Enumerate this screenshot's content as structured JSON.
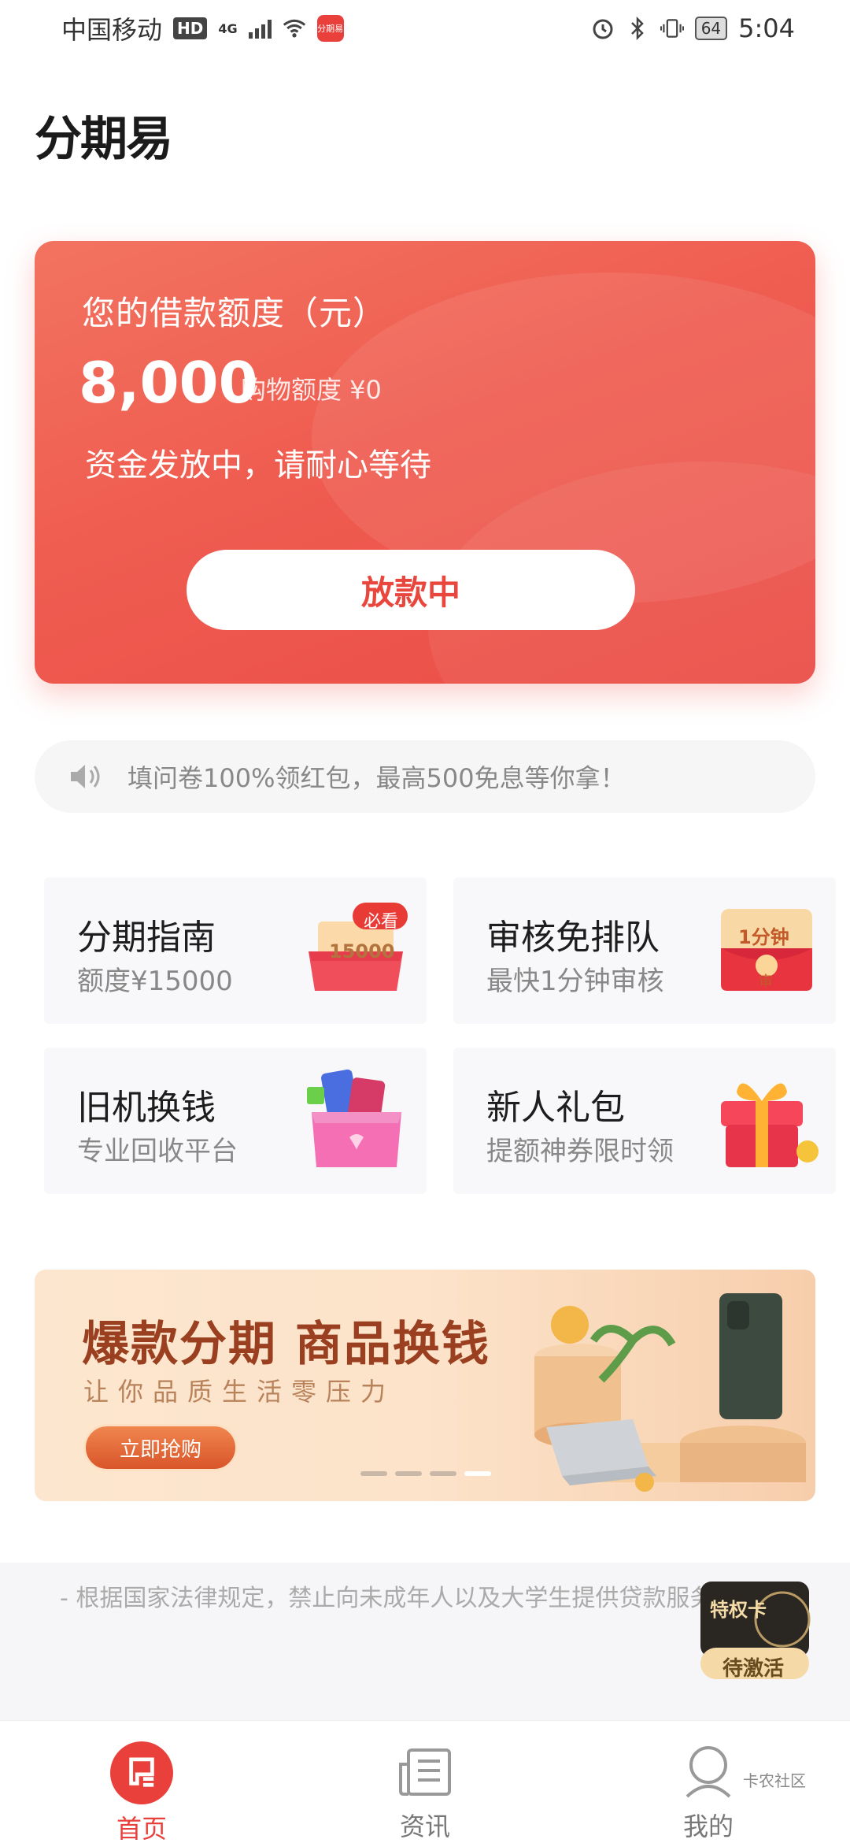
{
  "status_bar": {
    "carrier": "中国移动",
    "hd": "HD",
    "network": "4G",
    "app_badge": "分期易",
    "battery": "64",
    "time": "5:04"
  },
  "logo_text": "分期易",
  "credit_card": {
    "label": "您的借款额度（元）",
    "amount": "8,000",
    "shopping_quota": "购物额度 ¥0",
    "status": "资金发放中，请耐心等待",
    "button": "放款中"
  },
  "notice": "填问卷100%领红包，最高500免息等你拿！",
  "features": [
    {
      "title": "分期指南",
      "subtitle": "额度¥15000",
      "icon": "box-icon",
      "badge": "必看",
      "icon_text": "15000"
    },
    {
      "title": "审核免排队",
      "subtitle": "最快1分钟审核",
      "icon": "red-envelope-icon",
      "icon_text": "1分钟",
      "icon_sub": "审"
    },
    {
      "title": "旧机换钱",
      "subtitle": "专业回收平台",
      "icon": "phone-box-icon"
    },
    {
      "title": "新人礼包",
      "subtitle": "提额神券限时领",
      "icon": "gift-icon"
    }
  ],
  "banner": {
    "title": "爆款分期 商品换钱",
    "subtitle": "让你品质生活零压力",
    "button": "立即抢购",
    "slides": 4,
    "active_slide": 4
  },
  "legal": "- 根据国家法律规定，禁止向未成年人以及大学生提供贷款服务 -",
  "privilege": {
    "title": "特权卡",
    "status": "待激活"
  },
  "tabs": [
    {
      "label": "首页",
      "icon": "home-icon",
      "active": true
    },
    {
      "label": "资讯",
      "icon": "news-icon",
      "active": false
    },
    {
      "label": "我的",
      "icon": "profile-icon",
      "active": false
    }
  ],
  "watermark": "卡农社区",
  "colors": {
    "brand": "#e9403b",
    "card_start": "#f27360",
    "card_end": "#ea4d47"
  }
}
